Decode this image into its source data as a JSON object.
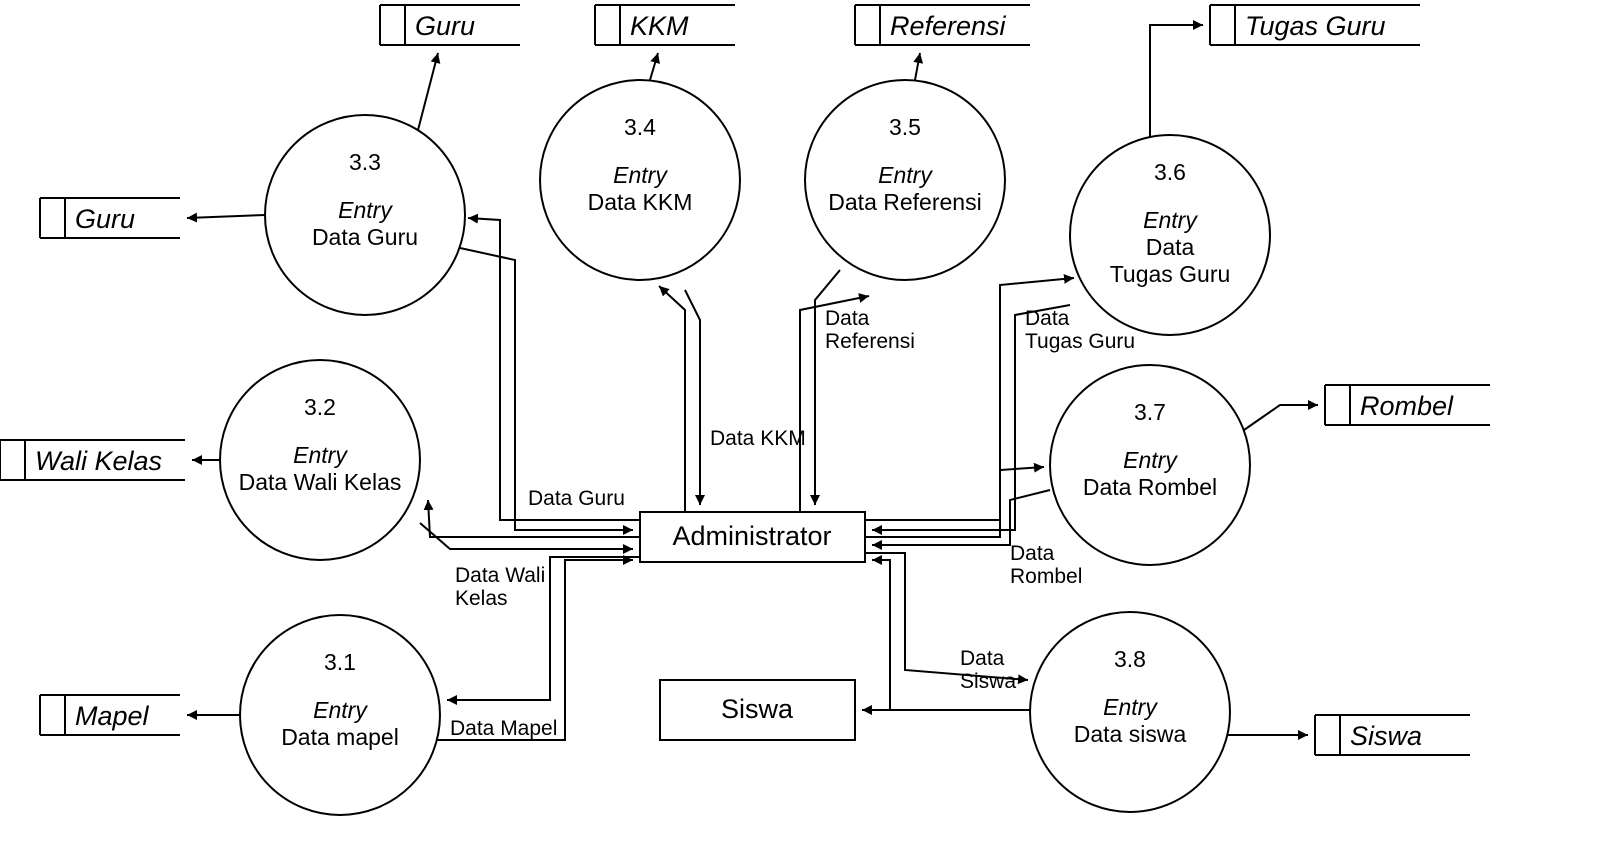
{
  "center_entity": "Administrator",
  "siswa_entity": "Siswa",
  "processes": {
    "p31": {
      "num": "3.1",
      "entry": "Entry",
      "label": "Data mapel"
    },
    "p32": {
      "num": "3.2",
      "entry": "Entry",
      "label": "Data Wali Kelas"
    },
    "p33": {
      "num": "3.3",
      "entry": "Entry",
      "label": "Data Guru"
    },
    "p34": {
      "num": "3.4",
      "entry": "Entry",
      "label": "Data KKM"
    },
    "p35": {
      "num": "3.5",
      "entry": "Entry",
      "label": "Data Referensi"
    },
    "p36": {
      "num": "3.6",
      "entry": "Entry",
      "label1": "Data",
      "label2": "Tugas Guru"
    },
    "p37": {
      "num": "3.7",
      "entry": "Entry",
      "label": "Data Rombel"
    },
    "p38": {
      "num": "3.8",
      "entry": "Entry",
      "label": "Data siswa"
    }
  },
  "stores": {
    "mapel": "Mapel",
    "wali": "Wali Kelas",
    "guru_left": "Guru",
    "guru_top": "Guru",
    "kkm": "KKM",
    "referensi": "Referensi",
    "tugas": "Tugas Guru",
    "rombel": "Rombel",
    "siswa": "Siswa"
  },
  "flows": {
    "mapel": "Data Mapel",
    "wali1": "Data Wali",
    "wali2": "Kelas",
    "guru": "Data Guru",
    "kkm": "Data KKM",
    "ref1": "Data",
    "ref2": "Referensi",
    "tugas1": "Data",
    "tugas2": "Tugas Guru",
    "rombel1": "Data",
    "rombel2": "Rombel",
    "siswa1": "Data",
    "siswa2": "Siswa"
  }
}
